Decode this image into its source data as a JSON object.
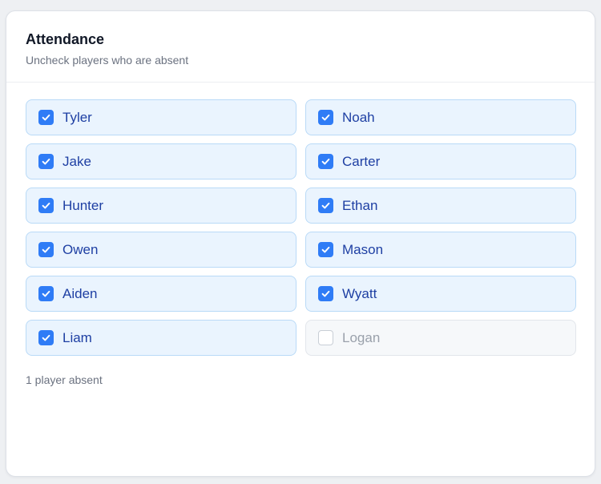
{
  "attendance": {
    "title": "Attendance",
    "subtitle": "Uncheck players who are absent",
    "players": [
      {
        "name": "Tyler",
        "present": true
      },
      {
        "name": "Noah",
        "present": true
      },
      {
        "name": "Jake",
        "present": true
      },
      {
        "name": "Carter",
        "present": true
      },
      {
        "name": "Hunter",
        "present": true
      },
      {
        "name": "Ethan",
        "present": true
      },
      {
        "name": "Owen",
        "present": true
      },
      {
        "name": "Mason",
        "present": true
      },
      {
        "name": "Aiden",
        "present": true
      },
      {
        "name": "Wyatt",
        "present": true
      },
      {
        "name": "Liam",
        "present": true
      },
      {
        "name": "Logan",
        "present": false
      }
    ],
    "absent_summary": "1 player absent"
  },
  "colors": {
    "accent": "#2f7cf6",
    "present_bg": "#eaf4fe",
    "present_border": "#b9daf7",
    "present_text": "#1e3fa3",
    "absent_bg": "#f6f8fa",
    "absent_text": "#9aa1ab"
  },
  "icons": {
    "checked": "check-icon"
  }
}
